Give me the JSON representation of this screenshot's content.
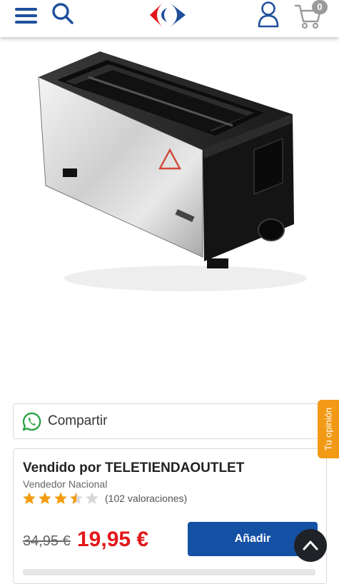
{
  "header": {
    "cart_count": "0",
    "brand_colors": {
      "blue": "#1f4f9c",
      "red": "#e3161b"
    }
  },
  "product": {
    "image_icon": "toaster-image"
  },
  "feedback": {
    "label": "Tu opinión"
  },
  "share": {
    "label": "Compartir",
    "icon": "whatsapp-icon"
  },
  "seller": {
    "sold_by_prefix": "Vendido por",
    "name": "TELETIENDAOUTLET",
    "type": "Vendedor Nacional",
    "rating": 3.5,
    "rating_max": 5,
    "reviews_label": "(102 valoraciones)"
  },
  "pricing": {
    "old_price": "34,95 €",
    "price": "19,95 €",
    "add_label": "Añadir"
  },
  "accent": {
    "button": "#1450a3",
    "price": "#e3161b",
    "feedback": "#f29a16"
  }
}
